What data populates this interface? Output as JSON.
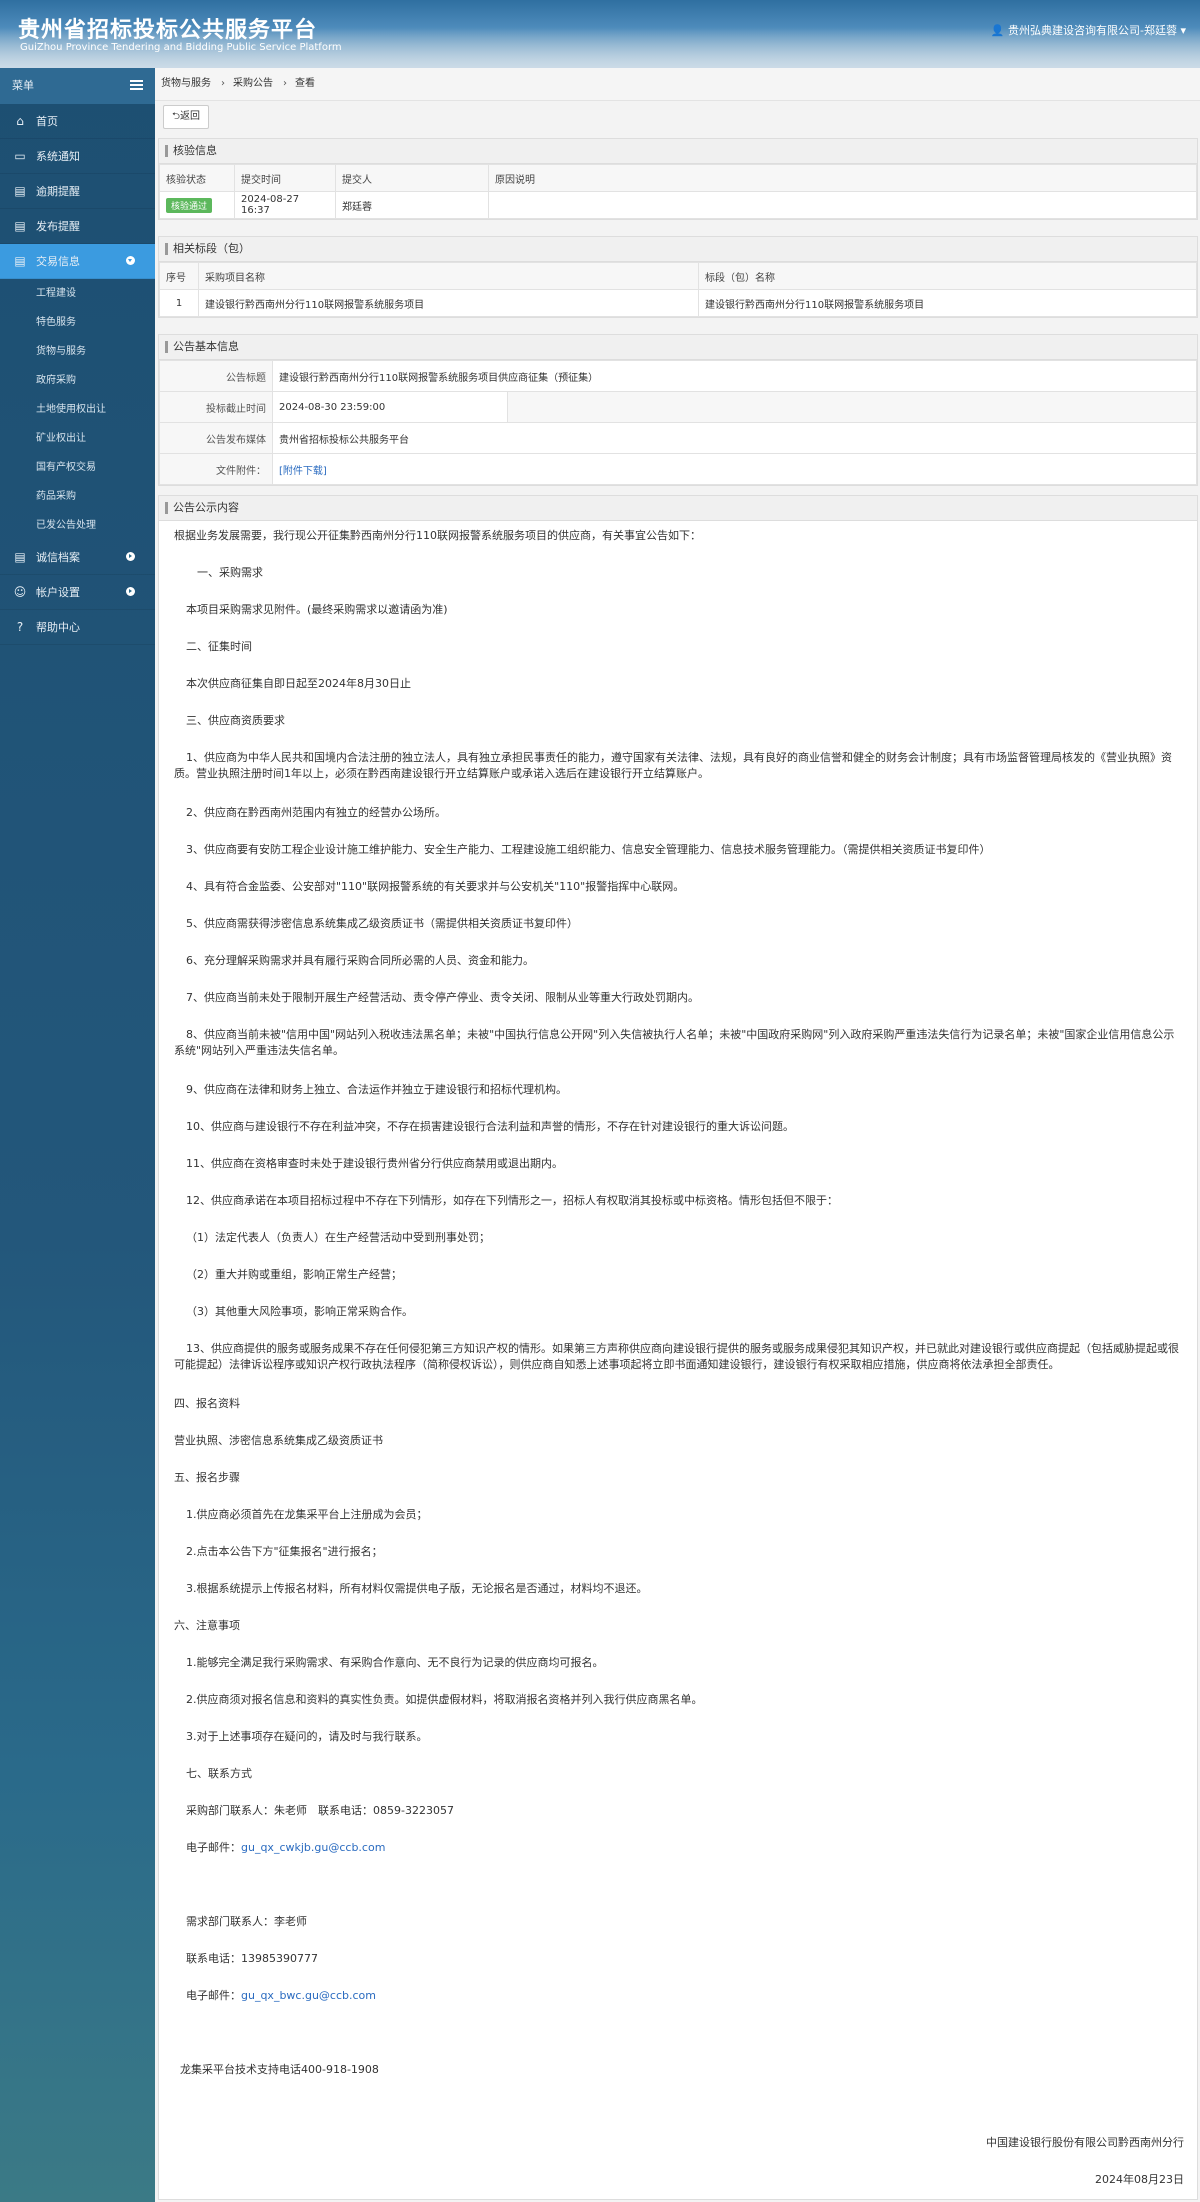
{
  "header": {
    "title": "贵州省招标投标公共服务平台",
    "subtitle": "GuiZhou Province Tendering and Bidding Public Service Platform",
    "user": "贵州弘典建设咨询有限公司-郑廷蓉"
  },
  "sidebar": {
    "menu_label": "菜单",
    "items": [
      {
        "label": "首页",
        "icon": "home-icon"
      },
      {
        "label": "系统通知",
        "icon": "monitor-icon"
      },
      {
        "label": "逾期提醒",
        "icon": "calendar-icon"
      },
      {
        "label": "发布提醒",
        "icon": "calendar-icon"
      },
      {
        "label": "交易信息",
        "icon": "calendar-icon"
      }
    ],
    "sub_items": [
      "工程建设",
      "特色服务",
      "货物与服务",
      "政府采购",
      "土地使用权出让",
      "矿业权出让",
      "国有产权交易",
      "药品采购",
      "已发公告处理"
    ],
    "items_after": [
      {
        "label": "诚信档案",
        "icon": "list-icon"
      },
      {
        "label": "帐户设置",
        "icon": "user-icon"
      },
      {
        "label": "帮助中心",
        "icon": "help-icon"
      }
    ]
  },
  "breadcrumb": [
    "货物与服务",
    "采购公告",
    "查看"
  ],
  "back_label": "返回",
  "check": {
    "title": "核验信息",
    "headers": [
      "核验状态",
      "提交时间",
      "提交人",
      "原因说明"
    ],
    "row": {
      "status": "核验通过",
      "time": "2024-08-27 16:37",
      "person": "郑廷蓉",
      "reason": ""
    }
  },
  "sections": {
    "title": "相关标段（包）",
    "headers": [
      "序号",
      "采购项目名称",
      "标段（包）名称"
    ],
    "rows": [
      [
        "1",
        "建设银行黔西南州分行110联网报警系统服务项目",
        "建设银行黔西南州分行110联网报警系统服务项目"
      ]
    ]
  },
  "basic": {
    "title": "公告基本信息",
    "rows": [
      {
        "label": "公告标题",
        "value": "建设银行黔西南州分行110联网报警系统服务项目供应商征集（预征集）"
      },
      {
        "label": "投标截止时间",
        "value": "2024-08-30 23:59:00"
      },
      {
        "label": "公告发布媒体",
        "value": "贵州省招标投标公共服务平台"
      },
      {
        "label": "文件附件：",
        "value": "[附件下载]"
      }
    ]
  },
  "notice": {
    "title": "公告公示内容",
    "paragraphs": [
      "根据业务发展需要，我行现公开征集黔西南州分行110联网报警系统服务项目的供应商，有关事宜公告如下：",
      "　一、采购需求",
      "本项目采购需求见附件。(最终采购需求以邀请函为准)",
      "二、征集时间",
      "本次供应商征集自即日起至2024年8月30日止",
      "三、供应商资质要求",
      "1、供应商为中华人民共和国境内合法注册的独立法人，具有独立承担民事责任的能力，遵守国家有关法律、法规，具有良好的商业信誉和健全的财务会计制度；具有市场监督管理局核发的《营业执照》资质。营业执照注册时间1年以上，必须在黔西南建设银行开立结算账户或承诺入选后在建设银行开立结算账户。",
      "2、供应商在黔西南州范围内有独立的经营办公场所。",
      "3、供应商要有安防工程企业设计施工维护能力、安全生产能力、工程建设施工组织能力、信息安全管理能力、信息技术服务管理能力。（需提供相关资质证书复印件）",
      "4、具有符合金监委、公安部对\"110\"联网报警系统的有关要求并与公安机关\"110\"报警指挥中心联网。",
      "5、供应商需获得涉密信息系统集成乙级资质证书（需提供相关资质证书复印件）",
      "6、充分理解采购需求并具有履行采购合同所必需的人员、资金和能力。",
      "7、供应商当前未处于限制开展生产经营活动、责令停产停业、责令关闭、限制从业等重大行政处罚期内。",
      "8、供应商当前未被\"信用中国\"网站列入税收违法黑名单；未被\"中国执行信息公开网\"列入失信被执行人名单；未被\"中国政府采购网\"列入政府采购严重违法失信行为记录名单；未被\"国家企业信用信息公示系统\"网站列入严重违法失信名单。",
      "9、供应商在法律和财务上独立、合法运作并独立于建设银行和招标代理机构。",
      "10、供应商与建设银行不存在利益冲突，不存在损害建设银行合法利益和声誉的情形，不存在针对建设银行的重大诉讼问题。",
      "11、供应商在资格审查时未处于建设银行贵州省分行供应商禁用或退出期内。",
      "12、供应商承诺在本项目招标过程中不存在下列情形，如存在下列情形之一，招标人有权取消其投标或中标资格。情形包括但不限于：",
      "（1）法定代表人（负责人）在生产经营活动中受到刑事处罚；",
      "（2）重大并购或重组，影响正常生产经营；",
      "（3）其他重大风险事项，影响正常采购合作。",
      "13、供应商提供的服务或服务成果不存在任何侵犯第三方知识产权的情形。如果第三方声称供应商向建设银行提供的服务或服务成果侵犯其知识产权，并已就此对建设银行或供应商提起（包括威胁提起或很可能提起）法律诉讼程序或知识产权行政执法程序（简称侵权诉讼），则供应商自知悉上述事项起将立即书面通知建设银行，建设银行有权采取相应措施，供应商将依法承担全部责任。",
      "四、报名资料",
      "营业执照、涉密信息系统集成乙级资质证书",
      "五、报名步骤",
      "1.供应商必须首先在龙集采平台上注册成为会员；",
      "2.点击本公告下方\"征集报名\"进行报名；",
      "3.根据系统提示上传报名材料，所有材料仅需提供电子版，无论报名是否通过，材料均不退还。",
      "六、注意事项",
      "1.能够完全满足我行采购需求、有采购合作意向、无不良行为记录的供应商均可报名。",
      "2.供应商须对报名信息和资料的真实性负责。如提供虚假材料，将取消报名资格并列入我行供应商黑名单。",
      "3.对于上述事项存在疑问的，请及时与我行联系。",
      "七、联系方式",
      "采购部门联系人：朱老师　联系电话：0859-3223057",
      "电子邮件：",
      "需求部门联系人：李老师",
      "联系电话：13985390777",
      "电子邮件：",
      "龙集采平台技术支持电话400-918-1908",
      "中国建设银行股份有限公司黔西南州分行",
      "2024年08月23日"
    ],
    "email1": "gu_qx_cwkjb.gu@ccb.com",
    "email2": "gu_qx_bwc.gu@ccb.com"
  }
}
